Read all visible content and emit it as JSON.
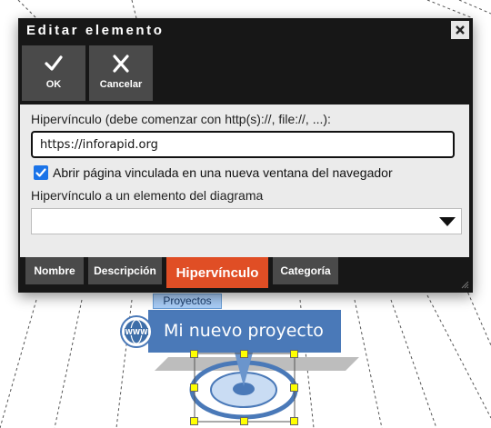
{
  "dialog": {
    "title": "Editar elemento",
    "close_icon": "close-icon",
    "toolbar": {
      "ok_label": "OK",
      "ok_icon": "checkmark-icon",
      "cancel_label": "Cancelar",
      "cancel_icon": "x-icon"
    },
    "hyperlink": {
      "label": "Hipervínculo (debe comenzar con http(s)://, file://, ...):",
      "value": "https://inforapid.org",
      "open_new_window_label": "Abrir página vinculada en una nueva ventana del navegador",
      "open_new_window_checked": true,
      "diagram_link_label": "Hipervínculo a un elemento del diagrama",
      "diagram_link_value": ""
    },
    "tabs": [
      {
        "label": "Nombre"
      },
      {
        "label": "Descripción"
      },
      {
        "label": "Hipervínculo",
        "active": true
      },
      {
        "label": "Categoría"
      }
    ]
  },
  "diagram": {
    "node_category": "Proyectos",
    "node_title": "Mi nuevo proyecto",
    "link_badge": "WWW",
    "link_icon": "globe-link-icon"
  },
  "colors": {
    "dialog_bg": "#171717",
    "button_bg": "#4a4a4a",
    "active_tab": "#e04e25",
    "checkbox": "#1a73e8",
    "node_blue": "#4a79b8",
    "category_tag": "#a9cdf7"
  }
}
